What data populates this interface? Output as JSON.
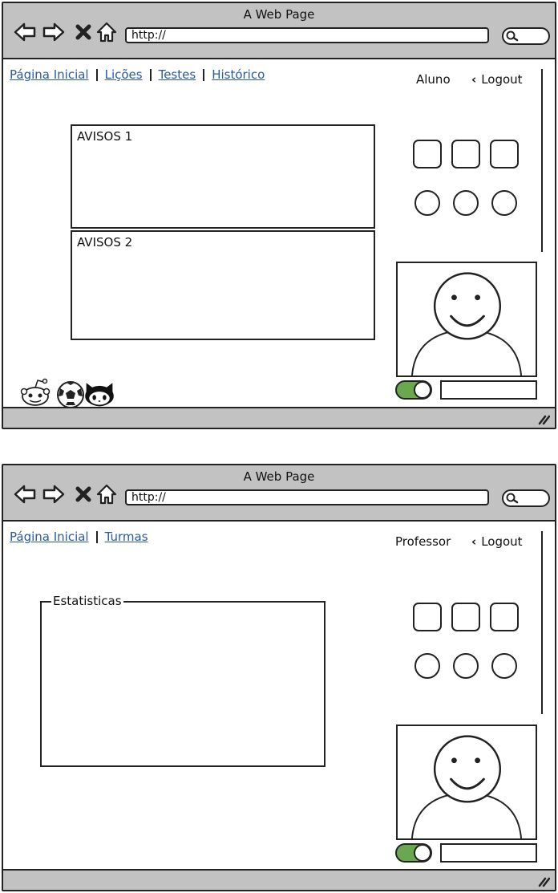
{
  "student_window": {
    "title": "A Web Page",
    "url": "http://",
    "nav": [
      "Página Inicial",
      "Lições",
      "Testes",
      "Histórico"
    ],
    "user_label": "Aluno",
    "logout_label": "Logout",
    "panels": [
      "AVISOS 1",
      "AVISOS 2"
    ],
    "social_icons": [
      "reddit-icon",
      "soccer-ball-icon",
      "github-icon"
    ],
    "toggle_on": true
  },
  "teacher_window": {
    "title": "A Web Page",
    "url": "http://",
    "nav": [
      "Página Inicial",
      "Turmas"
    ],
    "user_label": "Professor",
    "logout_label": "Logout",
    "stats_legend": "Estatisticas",
    "toggle_on": true
  },
  "colors": {
    "chrome_gray": "#c2c2c2",
    "link_blue": "#2a5aa0",
    "toggle_green": "#6aa84f",
    "stroke": "#222222"
  }
}
